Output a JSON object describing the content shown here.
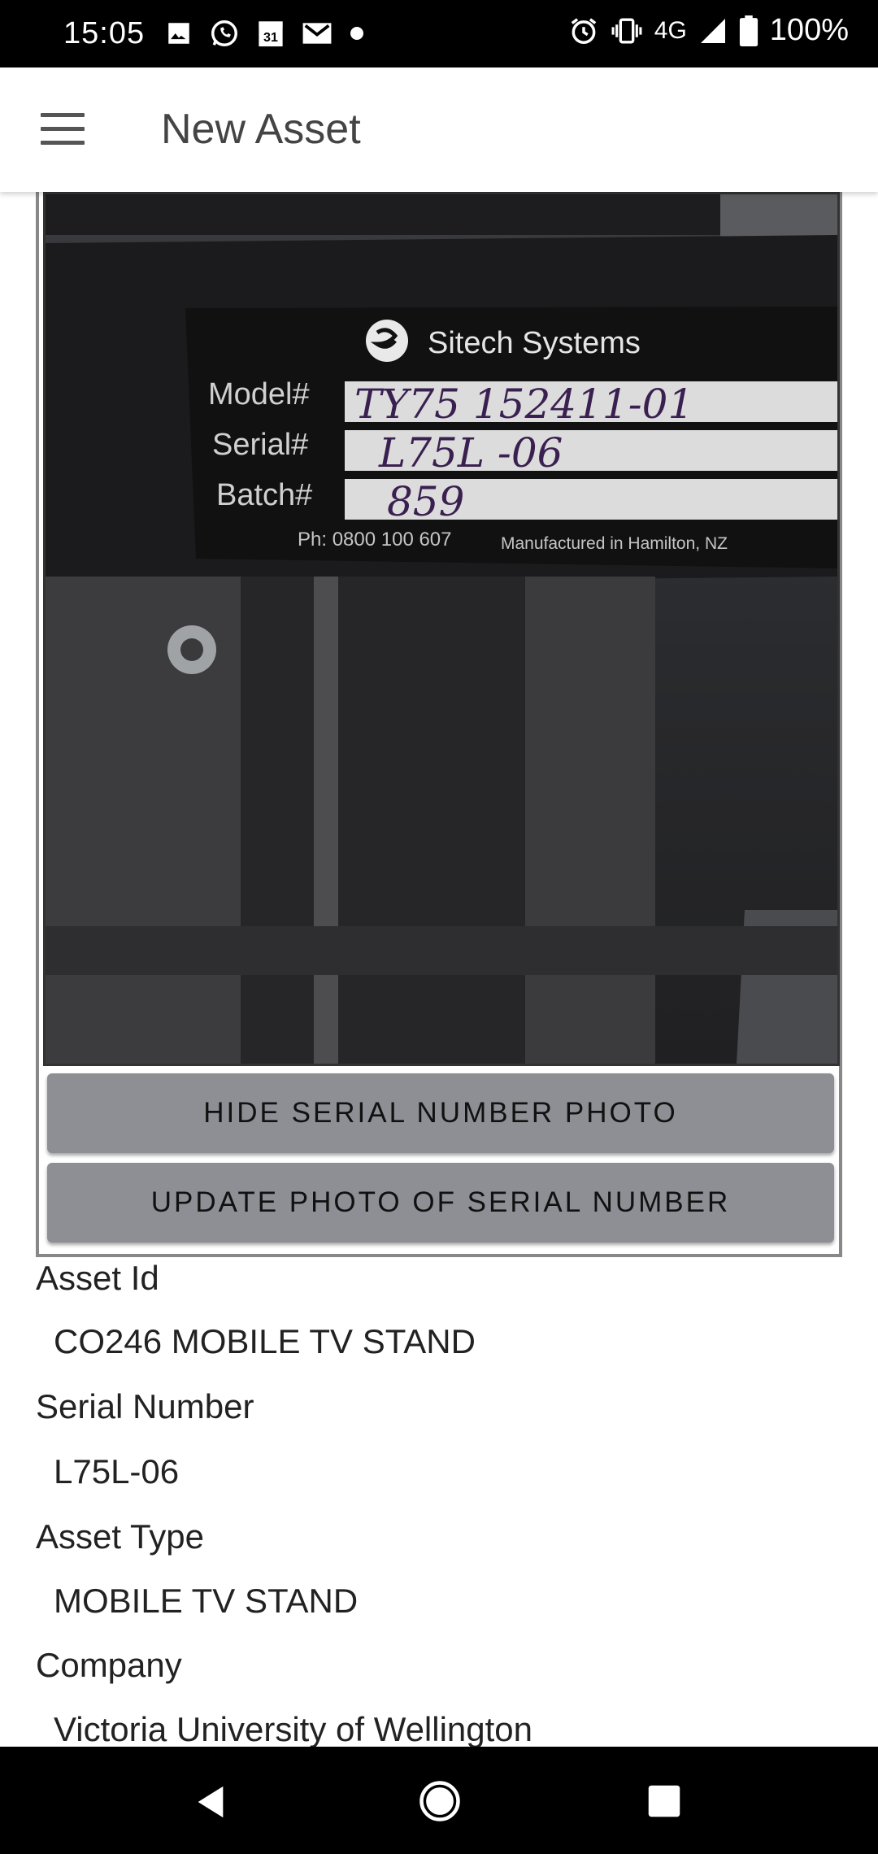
{
  "status_bar": {
    "time": "15:05",
    "network": "4G",
    "battery": "100%",
    "notification_icons": [
      "image-icon",
      "whatsapp-icon",
      "calendar-icon",
      "gmail-icon",
      "dot-icon"
    ],
    "calendar_day": "31",
    "system_icons": [
      "alarm-icon",
      "vibrate-icon",
      "signal-icon",
      "battery-icon"
    ]
  },
  "app_bar": {
    "title": "New Asset",
    "menu_icon": "hamburger-menu-icon"
  },
  "photo": {
    "brand": "Sitech Systems",
    "model_label": "Model#",
    "model_value": "TY75      152411-01",
    "serial_label": "Serial#",
    "serial_value": "L75L -06",
    "batch_label": "Batch#",
    "batch_value": "859",
    "phone": "Ph: 0800 100 607",
    "manufactured": "Manufactured in Hamilton, NZ"
  },
  "buttons": {
    "hide_photo": "HIDE SERIAL NUMBER PHOTO",
    "update_photo": "UPDATE PHOTO OF SERIAL NUMBER"
  },
  "fields": [
    {
      "label": "Asset Id",
      "value": "CO246 MOBILE TV STAND"
    },
    {
      "label": "Serial Number",
      "value": "L75L-06"
    },
    {
      "label": "Asset Type",
      "value": "MOBILE TV STAND"
    },
    {
      "label": "Company",
      "value": "Victoria University of Wellington"
    }
  ],
  "nav_bar": {
    "back_icon": "back-icon",
    "home_icon": "home-icon",
    "recents_icon": "recents-icon"
  }
}
